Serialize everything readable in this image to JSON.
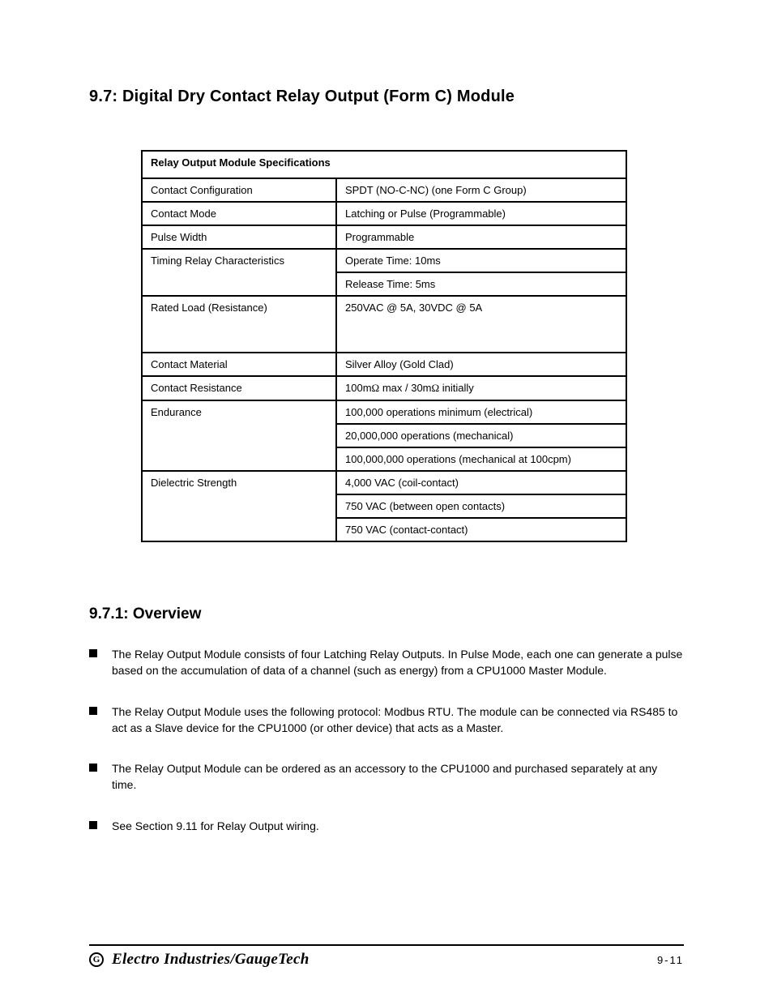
{
  "heading": "9.7: Digital Dry Contact Relay Output (Form C) Module",
  "table": {
    "title": "Relay Output Module Specifications",
    "rows": [
      {
        "label": "Contact Configuration",
        "value": "SPDT (NO-C-NC) (one Form C Group)"
      },
      {
        "label": "Contact Mode",
        "value": "Latching or Pulse (Programmable)"
      },
      {
        "label": "Pulse Width",
        "value": "Programmable"
      },
      {
        "label": "Timing Relay Characteristics",
        "values": [
          "Operate Time: 10ms",
          "Release Time: 5ms"
        ]
      },
      {
        "label": "Rated Load (Resistance)",
        "value": "250VAC @ 5A, 30VDC @ 5A",
        "tall": true
      },
      {
        "label": "Contact Material",
        "value": "Silver Alloy (Gold Clad)"
      },
      {
        "label": "Contact Resistance",
        "value_html": "100m<span class='ohm'>&Omega;</span> max / 30m<span class='ohm'>&Omega;</span> initially"
      },
      {
        "label": "Endurance",
        "values": [
          "100,000 operations minimum (electrical)",
          "20,000,000 operations (mechanical)",
          "100,000,000 operations (mechanical at 100cpm)"
        ]
      },
      {
        "label": "Dielectric Strength",
        "values": [
          "4,000 VAC (coil-contact)",
          "750 VAC (between open contacts)",
          "750 VAC (contact-contact)"
        ]
      }
    ]
  },
  "subheading": "9.7.1: Overview",
  "bullets": [
    "The Relay Output Module consists of four Latching Relay Outputs. In Pulse Mode, each one can generate a pulse based on the accumulation of data of a channel (such as energy) from a CPU1000 Master Module.",
    "The Relay Output Module uses the following protocol: Modbus RTU. The module can be connected via RS485 to act as a Slave device for the CPU1000 (or other device) that acts as a Master.",
    "The Relay Output Module can be ordered as an accessory to the CPU1000 and purchased separately at any time.",
    "See Section 9.11 for Relay Output wiring."
  ],
  "footer": {
    "brand": "Electro Industries/GaugeTech",
    "page": "9-11",
    "logo": "G"
  }
}
